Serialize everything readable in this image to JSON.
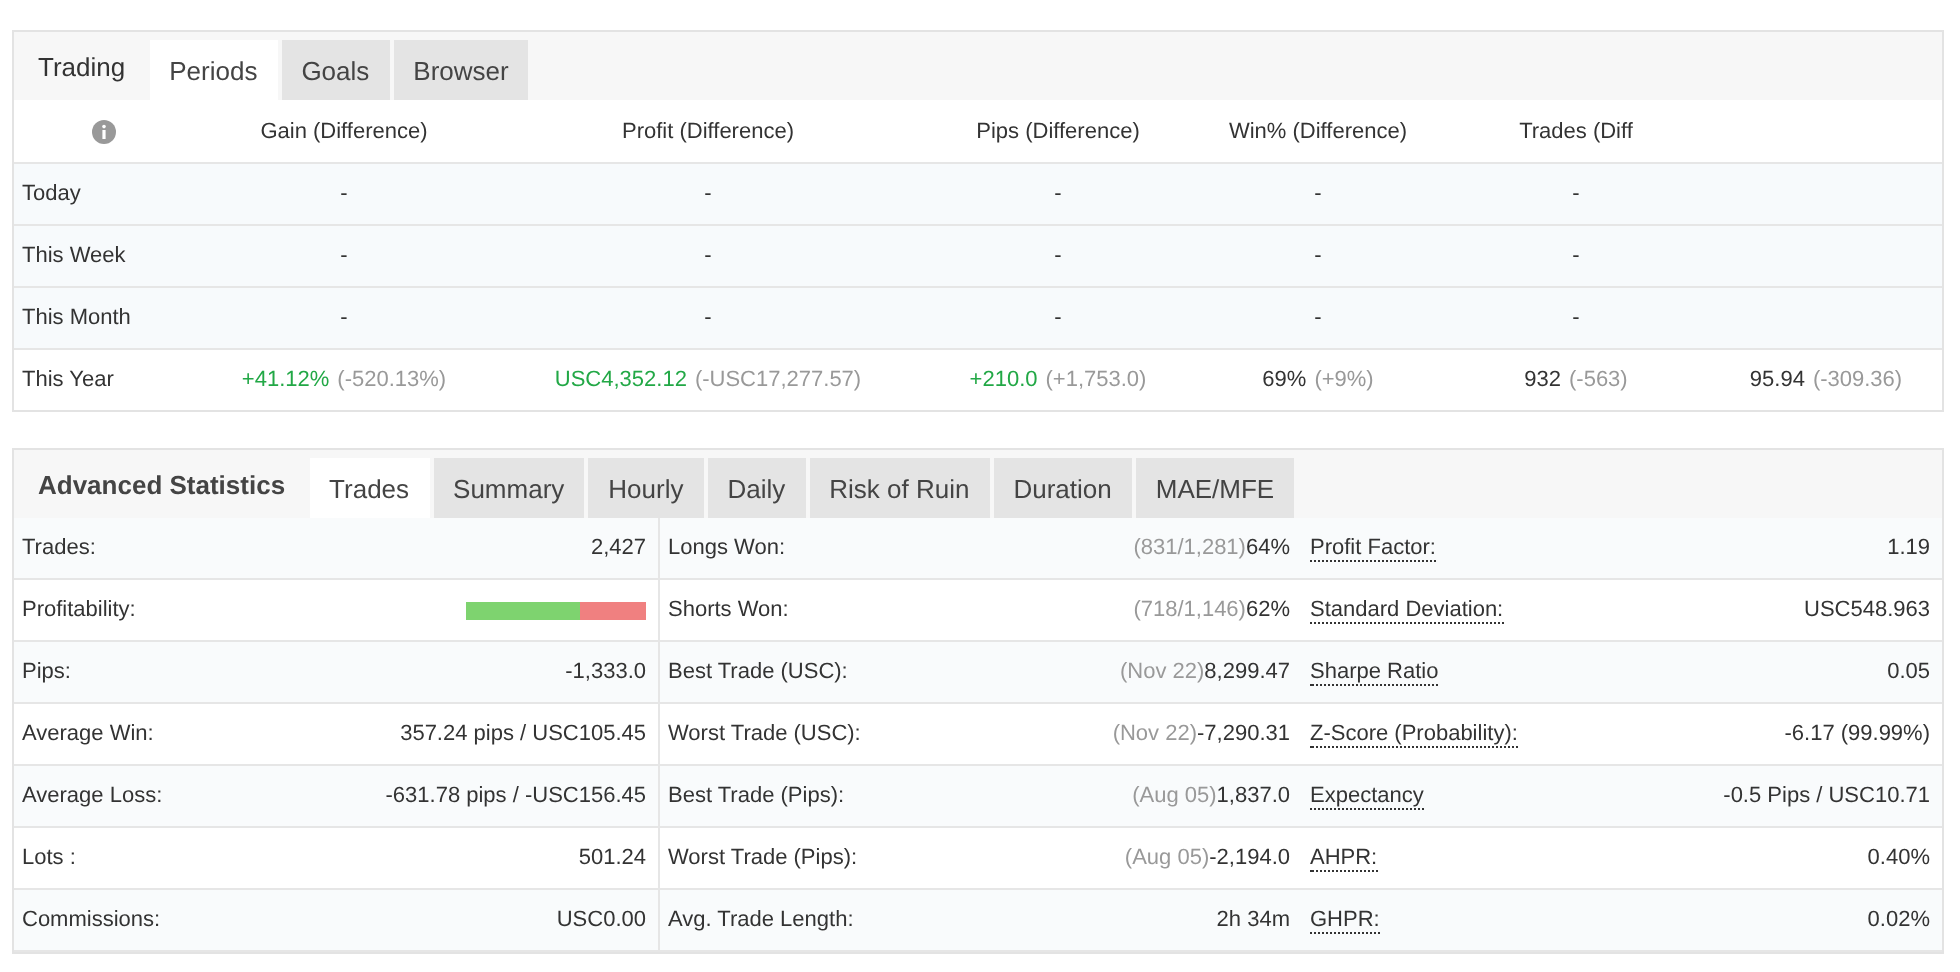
{
  "periods_panel": {
    "title": "Trading",
    "tabs": [
      {
        "label": "Periods",
        "selected": true
      },
      {
        "label": "Goals",
        "selected": false
      },
      {
        "label": "Browser",
        "selected": false
      }
    ],
    "columns": [
      "Gain (Difference)",
      "Profit (Difference)",
      "Pips (Difference)",
      "Win% (Difference)",
      "Trades (Diff"
    ],
    "rows": [
      {
        "period": "Today",
        "cells": [
          {
            "value": "-"
          },
          {
            "value": "-"
          },
          {
            "value": "-"
          },
          {
            "value": "-"
          },
          {
            "value": "-"
          }
        ]
      },
      {
        "period": "This Week",
        "cells": [
          {
            "value": "-"
          },
          {
            "value": "-"
          },
          {
            "value": "-"
          },
          {
            "value": "-"
          },
          {
            "value": "-"
          }
        ]
      },
      {
        "period": "This Month",
        "cells": [
          {
            "value": "-"
          },
          {
            "value": "-"
          },
          {
            "value": "-"
          },
          {
            "value": "-"
          },
          {
            "value": "-"
          }
        ]
      },
      {
        "period": "This Year",
        "cells": [
          {
            "value": "+41.12%",
            "diff": "(-520.13%)",
            "positive": true
          },
          {
            "value": "USC4,352.12",
            "diff": "(-USC17,277.57)",
            "positive": true
          },
          {
            "value": "+210.0",
            "diff": "(+1,753.0)",
            "positive": true
          },
          {
            "value": "69%",
            "diff": "(+9%)",
            "positive": false
          },
          {
            "value": "932",
            "diff": "(-563)",
            "positive": false
          },
          {
            "value": "95.94",
            "diff": "(-309.36)",
            "positive": false
          }
        ]
      }
    ]
  },
  "stats_panel": {
    "title": "Advanced Statistics",
    "tabs": [
      {
        "label": "Trades",
        "selected": true
      },
      {
        "label": "Summary",
        "selected": false
      },
      {
        "label": "Hourly",
        "selected": false
      },
      {
        "label": "Daily",
        "selected": false
      },
      {
        "label": "Risk of Ruin",
        "selected": false
      },
      {
        "label": "Duration",
        "selected": false
      },
      {
        "label": "MAE/MFE",
        "selected": false
      }
    ],
    "rows": [
      {
        "left": {
          "label": "Trades:",
          "kind": "text",
          "value": "2,427"
        },
        "middle": {
          "label": "Longs Won:",
          "note": "(831/1,281)",
          "value": "64%"
        },
        "right": {
          "label": "Profit Factor:",
          "value": "1.19"
        }
      },
      {
        "left": {
          "label": "Profitability:",
          "kind": "bar",
          "level": 0.63
        },
        "middle": {
          "label": "Shorts Won:",
          "note": "(718/1,146)",
          "value": "62%"
        },
        "right": {
          "label": "Standard Deviation:",
          "value": "USC548.963"
        }
      },
      {
        "left": {
          "label": "Pips:",
          "kind": "text",
          "value": "-1,333.0"
        },
        "middle": {
          "label": "Best Trade (USC):",
          "note": "(Nov 22)",
          "value": "8,299.47"
        },
        "right": {
          "label": "Sharpe Ratio",
          "value": "0.05"
        }
      },
      {
        "left": {
          "label": "Average Win:",
          "kind": "text",
          "value": "357.24 pips / USC105.45"
        },
        "middle": {
          "label": "Worst Trade (USC):",
          "note": "(Nov 22)",
          "value": "-7,290.31"
        },
        "right": {
          "label": "Z-Score (Probability):",
          "value": "-6.17 (99.99%)"
        }
      },
      {
        "left": {
          "label": "Average Loss:",
          "kind": "text",
          "value": "-631.78 pips / -USC156.45"
        },
        "middle": {
          "label": "Best Trade (Pips):",
          "note": "(Aug 05)",
          "value": "1,837.0"
        },
        "right": {
          "label": "Expectancy",
          "value": "-0.5 Pips / USC10.71"
        }
      },
      {
        "left": {
          "label": "Lots :",
          "kind": "text",
          "value": "501.24"
        },
        "middle": {
          "label": "Worst Trade (Pips):",
          "note": "(Aug 05)",
          "value": "-2,194.0"
        },
        "right": {
          "label": "AHPR:",
          "value": "0.40%"
        }
      },
      {
        "left": {
          "label": "Commissions:",
          "kind": "text",
          "value": "USC0.00"
        },
        "middle": {
          "label": "Avg. Trade Length:",
          "value": "2h 34m"
        },
        "right": {
          "label": "GHPR:",
          "value": "0.02%"
        }
      }
    ]
  }
}
